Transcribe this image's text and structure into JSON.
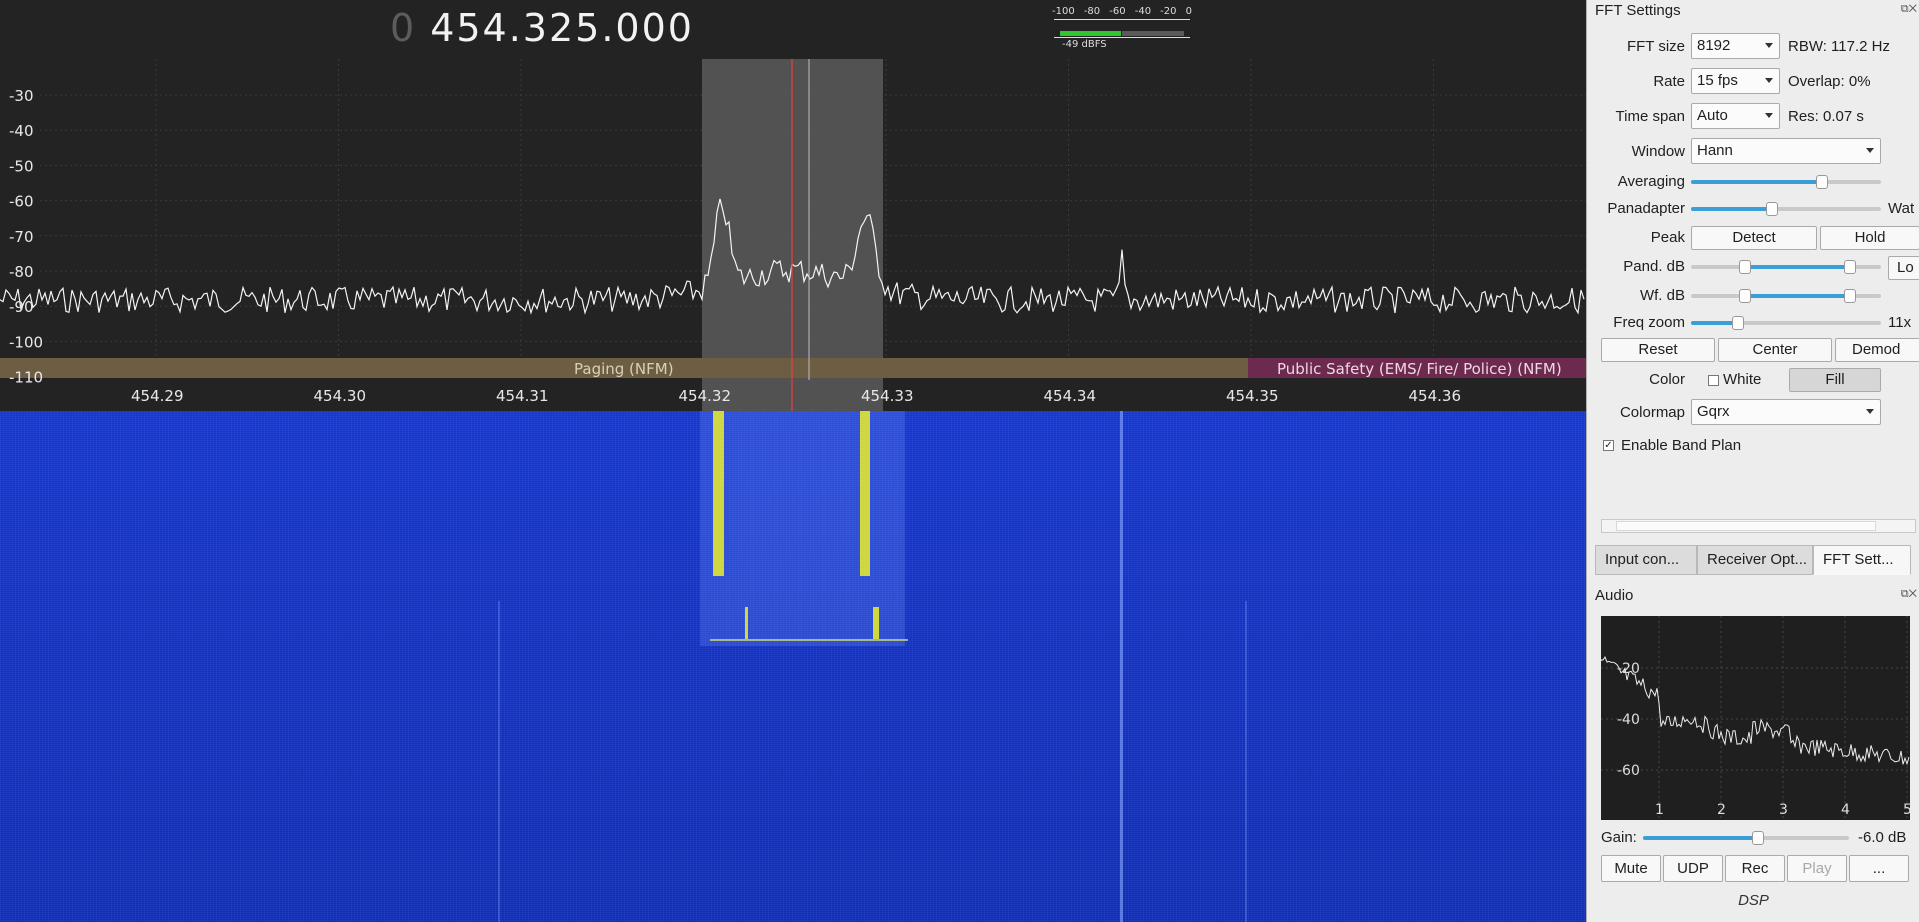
{
  "receiver": {
    "freq_lead": "0",
    "freq_value": "454.325.000"
  },
  "meter": {
    "ticks": [
      "-100",
      "-80",
      "-60",
      "-40",
      "-20",
      "0"
    ],
    "level_label": "-49 dBFS",
    "level_fraction": 0.45
  },
  "spectrum": {
    "y_ticks": [
      "-30",
      "-40",
      "-50",
      "-60",
      "-70",
      "-80",
      "-90",
      "-100",
      "-110"
    ],
    "x_ticks": [
      "454.29",
      "454.30",
      "454.31",
      "454.32",
      "454.33",
      "454.34",
      "454.35",
      "454.36"
    ],
    "band_plan": [
      {
        "label": "Paging (NFM)",
        "color": "#6d5e43"
      },
      {
        "label": "Public Safety (EMS/ Fire/ Police) (NFM)",
        "color": "#6c2a4f"
      }
    ],
    "trace_color": "#f4f4f4",
    "filter_color": "#5a5a5a",
    "center_line_color": "#e04040"
  },
  "fft_settings": {
    "title": "FFT Settings",
    "fft_size_label": "FFT size",
    "fft_size_value": "8192",
    "rbw": "RBW: 117.2 Hz",
    "rate_label": "Rate",
    "rate_value": "15 fps",
    "overlap": "Overlap: 0%",
    "timespan_label": "Time span",
    "timespan_value": "Auto",
    "res": "Res: 0.07 s",
    "window_label": "Window",
    "window_value": "Hann",
    "averaging_label": "Averaging",
    "averaging_level": 0.7,
    "panadapter_label": "Panadapter",
    "panadapter_level": 0.42,
    "panadapter_side": "Wat",
    "peak_label": "Peak",
    "detect_label": "Detect",
    "hold_label": "Hold",
    "pand_db_label": "Pand. dB",
    "pand_db_low": 0.27,
    "pand_db_high": 0.86,
    "pand_db_side": "Lo",
    "wf_db_label": "Wf. dB",
    "wf_db_low": 0.27,
    "wf_db_high": 0.86,
    "freq_zoom_label": "Freq zoom",
    "freq_zoom_level": 0.23,
    "freq_zoom_value": "11x",
    "reset_label": "Reset",
    "center_label": "Center",
    "demod_label": "Demod",
    "color_label": "Color",
    "white_label": "White",
    "fill_label": "Fill",
    "colormap_label": "Colormap",
    "colormap_value": "Gqrx",
    "band_plan_label": "Enable Band Plan",
    "band_plan_checked": "✓"
  },
  "tabs": [
    "Input con...",
    "Receiver Opt...",
    "FFT Sett..."
  ],
  "audio": {
    "title": "Audio",
    "y_ticks": [
      "-20",
      "-40",
      "-60"
    ],
    "x_ticks": [
      "1",
      "2",
      "3",
      "4",
      "5"
    ],
    "gain_label": "Gain:",
    "gain_value": "-6.0 dB",
    "gain_level": 0.56,
    "mute_label": "Mute",
    "udp_label": "UDP",
    "rec_label": "Rec",
    "play_label": "Play",
    "more_label": "..."
  },
  "dsp_label": "DSP"
}
